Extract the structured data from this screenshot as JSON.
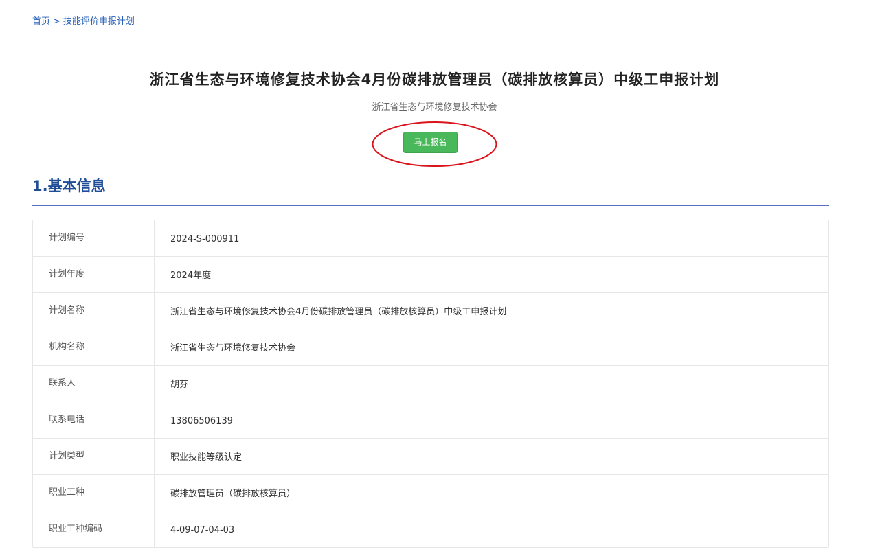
{
  "breadcrumb": {
    "home": "首页",
    "separator": ">",
    "current": "技能评价申报计划"
  },
  "plan_title": "浙江省生态与环境修复技术协会4月份碳排放管理员（碳排放核算员）中级工申报计划",
  "plan_org": "浙江省生态与环境修复技术协会",
  "apply_button": "马上报名",
  "section1_title": "1.基本信息",
  "info_rows": [
    {
      "label": "计划编号",
      "value": "2024-S-000911"
    },
    {
      "label": "计划年度",
      "value": "2024年度"
    },
    {
      "label": "计划名称",
      "value": "浙江省生态与环境修复技术协会4月份碳排放管理员（碳排放核算员）中级工申报计划"
    },
    {
      "label": "机构名称",
      "value": "浙江省生态与环境修复技术协会"
    },
    {
      "label": "联系人",
      "value": "胡芬"
    },
    {
      "label": "联系电话",
      "value": "13806506139"
    },
    {
      "label": "计划类型",
      "value": "职业技能等级认定"
    },
    {
      "label": "职业工种",
      "value": "碳排放管理员（碳排放核算员）"
    },
    {
      "label": "职业工种编码",
      "value": "4-09-07-04-03"
    }
  ],
  "colors": {
    "accent_green": "#49b85a",
    "link_blue": "#2a62b8",
    "section_blue": "#1f4e96",
    "highlight_red": "#d9141c"
  }
}
